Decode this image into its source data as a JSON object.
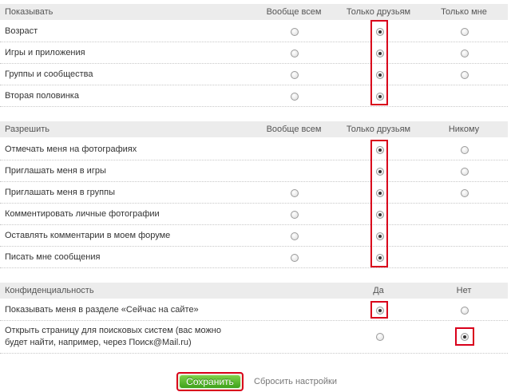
{
  "sections": [
    {
      "title": "Показывать",
      "columns": [
        "Вообще всем",
        "Только друзьям",
        "Только мне"
      ],
      "rows": [
        {
          "label": "Возраст",
          "options": [
            true,
            true,
            true
          ],
          "selected": 1
        },
        {
          "label": "Игры и приложения",
          "options": [
            true,
            true,
            true
          ],
          "selected": 1
        },
        {
          "label": "Группы и сообщества",
          "options": [
            true,
            true,
            true
          ],
          "selected": 1
        },
        {
          "label": "Вторая половинка",
          "options": [
            true,
            true,
            false
          ],
          "selected": 1
        }
      ]
    },
    {
      "title": "Разрешить",
      "columns": [
        "Вообще всем",
        "Только друзьям",
        "Никому"
      ],
      "rows": [
        {
          "label": "Отмечать меня на фотографиях",
          "options": [
            false,
            true,
            true
          ],
          "selected": 1
        },
        {
          "label": "Приглашать меня в игры",
          "options": [
            false,
            true,
            true
          ],
          "selected": 1
        },
        {
          "label": "Приглашать меня в группы",
          "options": [
            true,
            true,
            true
          ],
          "selected": 1
        },
        {
          "label": "Комментировать личные фотографии",
          "options": [
            true,
            true,
            false
          ],
          "selected": 1
        },
        {
          "label": "Оставлять комментарии в моем форуме",
          "options": [
            true,
            true,
            false
          ],
          "selected": 1
        },
        {
          "label": "Писать мне сообщения",
          "options": [
            true,
            true,
            false
          ],
          "selected": 1
        }
      ]
    },
    {
      "title": "Конфиденциальность",
      "columns": [
        "Да",
        "Нет"
      ],
      "rows": [
        {
          "label": "Показывать меня в разделе «Сейчас на сайте»",
          "options": [
            true,
            true
          ],
          "selected": 0
        },
        {
          "label": "Открыть страницу для поисковых систем (вас можно будет найти, например, через Поиск@Mail.ru)",
          "options": [
            true,
            true
          ],
          "selected": 1
        }
      ]
    }
  ],
  "footer": {
    "save_label": "Сохранить",
    "reset_label": "Сбросить настройки"
  },
  "colors": {
    "highlight": "#d9001b",
    "header_bg": "#ececec",
    "save_button": "#4fb524"
  }
}
